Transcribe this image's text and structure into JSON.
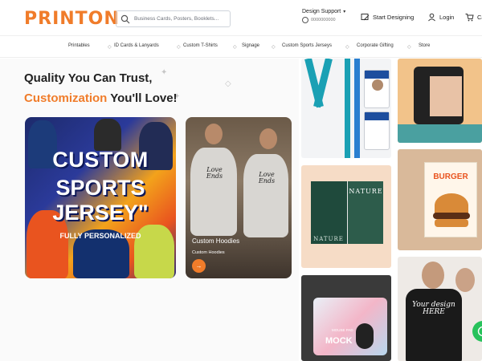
{
  "header": {
    "logo_text": "PRINTON",
    "search_placeholder": "Business Cards, Posters, Booklets...",
    "support_label": "Design Support",
    "support_phone": "0000000000",
    "start_designing": "Start Designing",
    "login": "Login",
    "cart": "Ca"
  },
  "nav": {
    "items": [
      "Printables",
      "ID Cards & Lanyards",
      "Custom T-Shirts",
      "Signage",
      "Custom Sports Jerseys",
      "Corporate Gifting",
      "Store"
    ]
  },
  "hero": {
    "title_line1": "Quality You Can Trust,",
    "title_accent": "Customization",
    "title_line2_rest": " You'll Love!"
  },
  "cards": {
    "jersey": {
      "line1": "CUSTOM",
      "line2": "SPORTS",
      "line3": "JERSEY\"",
      "line4": "FULLY PERSONALIZED"
    },
    "hoodie": {
      "title": "Custom Hoodies",
      "subtitle": "Custom Hoodies",
      "print": "Love Ends",
      "arrow": "→"
    }
  },
  "tiles": {
    "magazine_title": "NATURE",
    "magazine_bottom": "NATURE",
    "burger_title": "BURGER",
    "mousepad_text": "MOCK",
    "mousepad_small": "MOUSE PAD",
    "tshirt_text": "Your design HERE"
  },
  "colors": {
    "accent": "#f07c2a",
    "whatsapp": "#27c25b"
  }
}
